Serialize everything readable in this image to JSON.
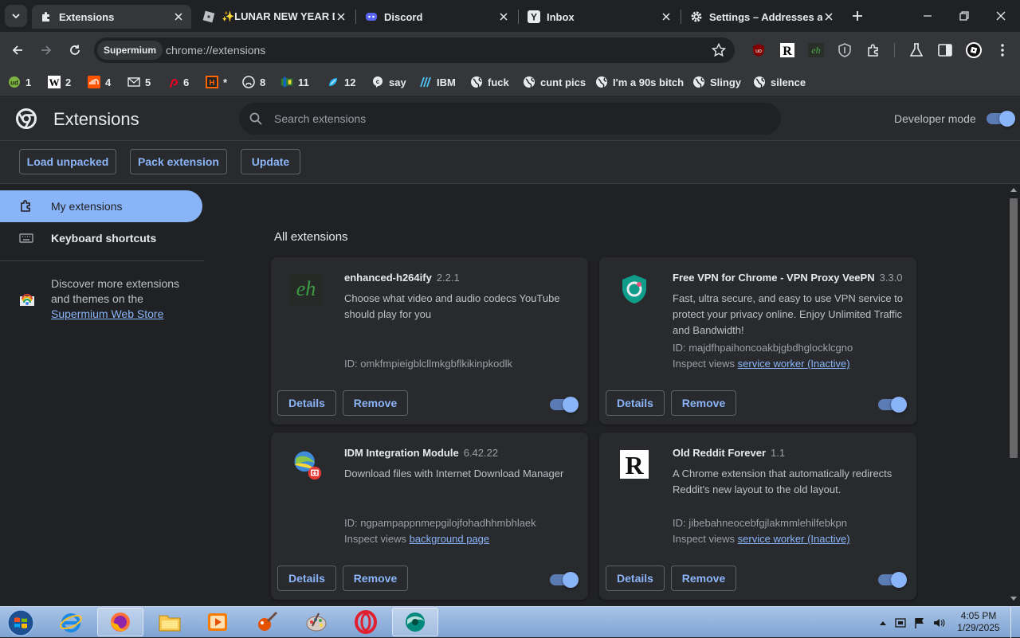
{
  "tabs": [
    {
      "title": "Extensions",
      "icon": "puzzle-icon",
      "active": true
    },
    {
      "title": "✨LUNAR NEW YEAR Dr",
      "icon": "roblox-icon",
      "active": false
    },
    {
      "title": "Discord",
      "icon": "discord-icon",
      "active": false
    },
    {
      "title": "Inbox",
      "icon": "yahoo-icon",
      "active": false
    },
    {
      "title": "Settings – Addresses and",
      "icon": "gear-icon",
      "active": false
    }
  ],
  "omnibox": {
    "site_chip": "Supermium",
    "url": "chrome://extensions"
  },
  "bookmarks": [
    {
      "label": "1",
      "icon": "bookmark-1-icon"
    },
    {
      "label": "2",
      "icon": "wikipedia-icon"
    },
    {
      "label": "4",
      "icon": "soundcloud-icon"
    },
    {
      "label": "5",
      "icon": "mail-icon"
    },
    {
      "label": "6",
      "icon": "pinterest-icon"
    },
    {
      "label": "*",
      "icon": "hackernews-icon"
    },
    {
      "label": "8",
      "icon": "github-icon"
    },
    {
      "label": "11",
      "icon": "bookmark-11-icon"
    },
    {
      "label": "12",
      "icon": "bookmark-12-icon"
    },
    {
      "label": "say",
      "icon": "bookmark-say-icon"
    },
    {
      "label": "IBM",
      "icon": "ibm-icon"
    },
    {
      "label": "fuck",
      "icon": "globe-icon"
    },
    {
      "label": "cunt pics",
      "icon": "globe-icon"
    },
    {
      "label": "I'm a 90s bitch",
      "icon": "globe-icon"
    },
    {
      "label": "Slingy",
      "icon": "globe-icon"
    },
    {
      "label": "silence",
      "icon": "globe-icon"
    }
  ],
  "header": {
    "title": "Extensions",
    "search_placeholder": "Search extensions",
    "developer_mode_label": "Developer mode",
    "developer_mode": true
  },
  "actions": {
    "load_unpacked": "Load unpacked",
    "pack_extension": "Pack extension",
    "update": "Update"
  },
  "sidebar": {
    "items": [
      {
        "label": "My extensions",
        "icon": "extensions-icon",
        "active": true
      },
      {
        "label": "Keyboard shortcuts",
        "icon": "keyboard-icon",
        "active": false
      }
    ],
    "discover_text": "Discover more extensions and themes on the",
    "store_link": "Supermium Web Store"
  },
  "main": {
    "section_title": "All extensions",
    "extensions": [
      {
        "name": "enhanced-h264ify",
        "version": "2.2.1",
        "description": "Choose what video and audio codecs YouTube should play for you",
        "id": "ID: omkfmpieigblcllmkgbflkikinpkodlk",
        "inspect_label": "",
        "inspect_link": "",
        "enabled": true,
        "icon": "eh-icon"
      },
      {
        "name": "Free VPN for Chrome - VPN Proxy VeePN",
        "version": "3.3.0",
        "description": "Fast, ultra secure, and easy to use VPN service to protect your privacy online. Enjoy Unlimited Traffic and Bandwidth!",
        "id": "ID: majdfhpaihoncoakbjgbdhglocklcgno",
        "inspect_label": "Inspect views",
        "inspect_link": "service worker (Inactive)",
        "enabled": true,
        "icon": "veepn-shield-icon"
      },
      {
        "name": "IDM Integration Module",
        "version": "6.42.22",
        "description": "Download files with Internet Download Manager",
        "id": "ID: ngpampappnmepgilojfohadhhmbhlaek",
        "inspect_label": "Inspect views",
        "inspect_link": "background page",
        "enabled": true,
        "icon": "idm-icon"
      },
      {
        "name": "Old Reddit Forever",
        "version": "1.1",
        "description": "A Chrome extension that automatically redirects Reddit's new layout to the old layout.",
        "id": "ID: jibebahneocebfgjlakmmlehilfebkpn",
        "inspect_label": "Inspect views",
        "inspect_link": "service worker (Inactive)",
        "enabled": true,
        "icon": "reddit-r-icon"
      }
    ],
    "details_label": "Details",
    "remove_label": "Remove"
  },
  "taskbar": {
    "apps": [
      "internet-explorer-icon",
      "firefox-icon",
      "file-explorer-icon",
      "media-player-icon",
      "paint-brush-icon",
      "palette-icon",
      "opera-icon",
      "browser-icon"
    ],
    "clock_time": "4:05 PM",
    "clock_date": "1/29/2025"
  },
  "colors": {
    "accent": "#8ab4f8",
    "background": "#202124",
    "surface": "#292a2d",
    "toolbar": "#35363a"
  }
}
